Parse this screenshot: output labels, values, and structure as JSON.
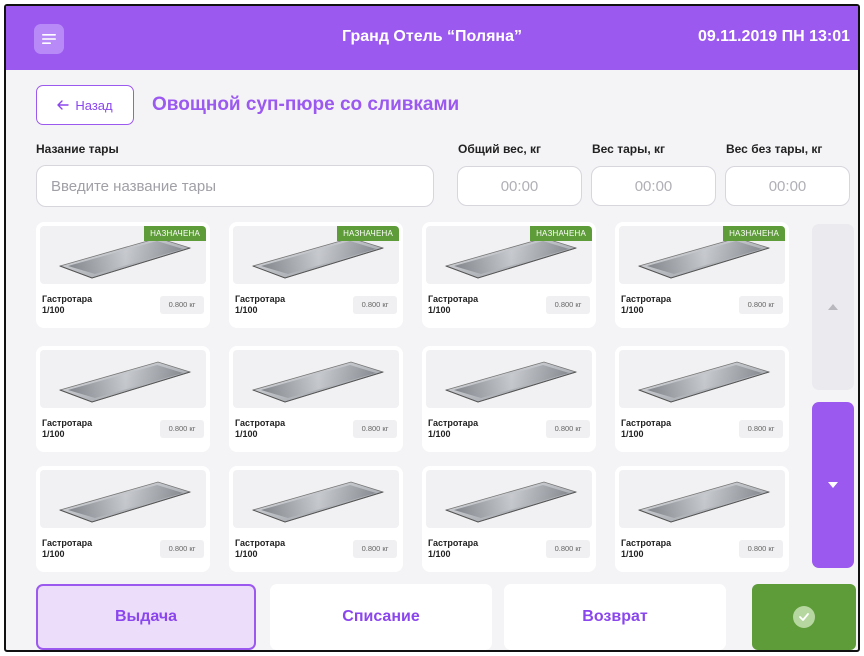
{
  "header": {
    "menu_icon": "hamburger-menu-icon",
    "title": "Гранд Отель “Поляна”",
    "datetime": "09.11.2019 ПН 13:01"
  },
  "colors": {
    "accent": "#9b59f0",
    "accent_light": "#ecdefb",
    "success": "#5d9c38"
  },
  "page": {
    "back_label": "Назад",
    "back_icon": "arrow-left-icon",
    "dish_title": "Овощной суп-пюре со сливками"
  },
  "form": {
    "container_name_label": "Назание тары",
    "container_name_placeholder": "Введите название тары",
    "total_weight_label": "Общий вес, кг",
    "total_weight_value": "00:00",
    "tare_weight_label": "Вес тары, кг",
    "tare_weight_value": "00:00",
    "net_weight_label": "Вес без тары, кг",
    "net_weight_value": "00:00"
  },
  "containers": [
    {
      "name": "Гастротара\n1/100",
      "weight": "0.800 кг",
      "badge": "НАЗНАЧЕНА"
    },
    {
      "name": "Гастротара\n1/100",
      "weight": "0.800 кг",
      "badge": "НАЗНАЧЕНА"
    },
    {
      "name": "Гастротара\n1/100",
      "weight": "0.800 кг",
      "badge": "НАЗНАЧЕНА"
    },
    {
      "name": "Гастротара\n1/100",
      "weight": "0.800 кг",
      "badge": "НАЗНАЧЕНА"
    },
    {
      "name": "Гастротара\n1/100",
      "weight": "0.800 кг",
      "badge": ""
    },
    {
      "name": "Гастротара\n1/100",
      "weight": "0.800 кг",
      "badge": ""
    },
    {
      "name": "Гастротара\n1/100",
      "weight": "0.800 кг",
      "badge": ""
    },
    {
      "name": "Гастротара\n1/100",
      "weight": "0.800 кг",
      "badge": ""
    },
    {
      "name": "Гастротара\n1/100",
      "weight": "0.800 кг",
      "badge": ""
    },
    {
      "name": "Гастротара\n1/100",
      "weight": "0.800 кг",
      "badge": ""
    },
    {
      "name": "Гастротара\n1/100",
      "weight": "0.800 кг",
      "badge": ""
    },
    {
      "name": "Гастротара\n1/100",
      "weight": "0.800 кг",
      "badge": ""
    }
  ],
  "scroll": {
    "up_icon": "triangle-up-icon",
    "down_icon": "triangle-down-icon"
  },
  "actions": {
    "issue_label": "Выдача",
    "writeoff_label": "Списание",
    "return_label": "Возврат",
    "confirm_icon": "check-circle-icon"
  }
}
